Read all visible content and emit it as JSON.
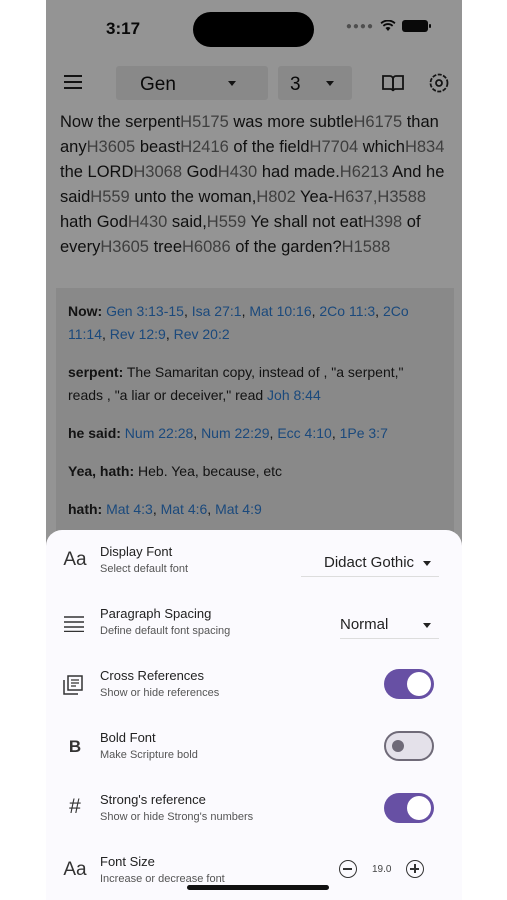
{
  "status": {
    "time": "3:17"
  },
  "toolbar": {
    "book": "Gen",
    "chapter": "3"
  },
  "verse": {
    "segments": [
      {
        "t": "Now the serpent"
      },
      {
        "s": "H5175"
      },
      {
        "t": " was more subtle"
      },
      {
        "s": "H6175"
      },
      {
        "t": " than any"
      },
      {
        "s": "H3605"
      },
      {
        "t": " beast"
      },
      {
        "s": "H2416"
      },
      {
        "t": " of the field"
      },
      {
        "s": "H7704"
      },
      {
        "t": " which"
      },
      {
        "s": "H834"
      },
      {
        "t": " the  LORD"
      },
      {
        "s": "H3068"
      },
      {
        "t": " God"
      },
      {
        "s": "H430"
      },
      {
        "t": " had made."
      },
      {
        "s": "H6213"
      },
      {
        "t": " And he said"
      },
      {
        "s": "H559"
      },
      {
        "t": " unto the woman,"
      },
      {
        "s": "H802"
      },
      {
        "t": " Yea-"
      },
      {
        "s": "H637,H3588"
      },
      {
        "t": " hath God"
      },
      {
        "s": "H430"
      },
      {
        "t": " said,"
      },
      {
        "s": "H559"
      },
      {
        "t": " Ye shall not eat"
      },
      {
        "s": "H398"
      },
      {
        "t": " of every"
      },
      {
        "s": "H3605"
      },
      {
        "t": " tree"
      },
      {
        "s": "H6086"
      },
      {
        "t": " of the garden?"
      },
      {
        "s": "H1588"
      }
    ]
  },
  "notes": [
    {
      "term": "Now:",
      "text": "",
      "refs": [
        "Gen 3:13-15",
        "Isa 27:1",
        "Mat 10:16",
        "2Co 11:3",
        "2Co 11:14",
        "Rev 12:9",
        "Rev 20:2"
      ]
    },
    {
      "term": "serpent:",
      "text": "The Samaritan copy, instead of , \"a serpent,\" reads , \"a liar or deceiver,\" read ",
      "refs": [
        "Joh 8:44"
      ]
    },
    {
      "term": "he said:",
      "text": "",
      "refs": [
        "Num 22:28",
        "Num 22:29",
        "Ecc 4:10",
        "1Pe 3:7"
      ]
    },
    {
      "term": "Yea, hath:",
      "text": " Heb. Yea, because, etc",
      "refs": []
    },
    {
      "term": "hath:",
      "text": "",
      "refs": [
        "Mat 4:3",
        "Mat 4:6",
        "Mat 4:9"
      ]
    }
  ],
  "settings": {
    "display_font": {
      "icon": "Aa",
      "title": "Display Font",
      "subtitle": "Select default font",
      "value": "Didact Gothic"
    },
    "paragraph_spacing": {
      "icon": "lines-icon",
      "title": "Paragraph Spacing",
      "subtitle": "Define default font spacing",
      "value": "Normal"
    },
    "cross_references": {
      "icon": "library-icon",
      "title": "Cross References",
      "subtitle": "Show or hide references",
      "enabled": true
    },
    "bold_font": {
      "icon": "B",
      "title": "Bold Font",
      "subtitle": "Make Scripture bold",
      "enabled": false
    },
    "strongs": {
      "icon": "#",
      "title": "Strong's reference",
      "subtitle": "Show or hide Strong's numbers",
      "enabled": true
    },
    "font_size": {
      "icon": "Aa",
      "title": "Font Size",
      "subtitle": "Increase or decrease font",
      "value": "19.0"
    }
  },
  "colors": {
    "accent": "#6750a4",
    "strongs": "#6b6b6b",
    "ref": "#2f7fd6"
  }
}
